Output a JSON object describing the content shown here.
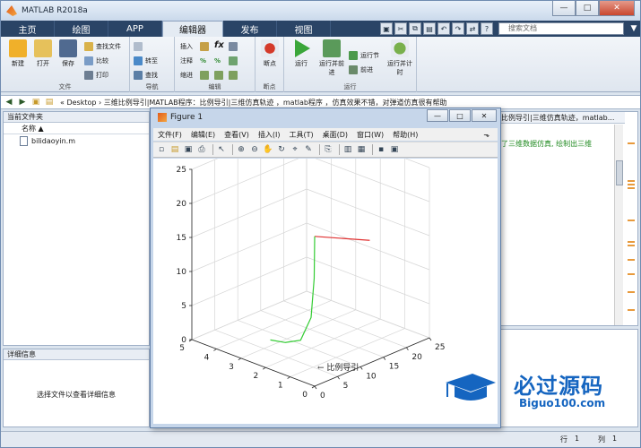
{
  "window": {
    "title": "MATLAB R2018a",
    "min": "—",
    "max": "□",
    "close": "✕"
  },
  "tabs": [
    {
      "label": "主页"
    },
    {
      "label": "绘图"
    },
    {
      "label": "APP"
    },
    {
      "label": "编辑器"
    },
    {
      "label": "发布"
    },
    {
      "label": "视图"
    }
  ],
  "search": {
    "placeholder": "搜索文档"
  },
  "ribbon": {
    "file_group": "文件",
    "new": "新建",
    "open": "打开",
    "save": "保存",
    "find_files": "查找文件",
    "compare": "比较",
    "print": "打印",
    "nav_group": "导航",
    "goto": "转至",
    "find": "查找",
    "edit_group": "编辑",
    "insert": "插入",
    "comment": "注释",
    "indent": "缩进",
    "bp_group": "断点",
    "breakpoints": "断点",
    "run_group": "运行",
    "run": "运行",
    "run_advance": "运行并前进",
    "run_section": "运行节",
    "advance": "前进",
    "run_time": "运行并计时"
  },
  "address": {
    "path": "« Desktop › 三维比例导引|MATLAB程序：比例导引|三维仿真轨迹 ，matlab程序 ，仿真效果不错，对弹道仿真很有帮助"
  },
  "file_panel": {
    "title": "当前文件夹",
    "col_name": "名称 ▲",
    "files": [
      "bilidaoyin.m"
    ]
  },
  "detail_panel": {
    "title": "详细信息",
    "message": "选择文件以查看详细信息"
  },
  "editor": {
    "tab": "比例导引|三维仿真轨迹，matlab...",
    "comment": "了三维数据仿真, 绘制出三维"
  },
  "status": {
    "row_label": "行",
    "row": "1",
    "col_label": "列",
    "col": "1"
  },
  "figure": {
    "title": "Figure 1",
    "menu": [
      "文件(F)",
      "编辑(E)",
      "查看(V)",
      "插入(I)",
      "工具(T)",
      "桌面(D)",
      "窗口(W)",
      "帮助(H)"
    ],
    "min": "—",
    "max": "□",
    "close": "✕"
  },
  "chart_data": {
    "type": "line3d",
    "title": "",
    "annotation": "← 比例导引",
    "xlim": [
      0,
      25
    ],
    "ylim": [
      0,
      5
    ],
    "zlim": [
      0,
      25
    ],
    "x_ticks": [
      "0",
      "5",
      "10",
      "15",
      "20",
      "25"
    ],
    "y_ticks": [
      "0",
      "1",
      "2",
      "3",
      "4",
      "5"
    ],
    "z_ticks": [
      "0",
      "5",
      "10",
      "15",
      "20",
      "25"
    ],
    "grid": true,
    "series": [
      {
        "color": "#e03030",
        "x": [
          0,
          12
        ],
        "y": [
          0,
          0
        ],
        "z": [
          22,
          18
        ]
      },
      {
        "color": "#33cc33",
        "x": [
          0,
          1.5,
          3.5,
          5.5,
          7,
          8
        ],
        "y": [
          0,
          0.3,
          0.8,
          1.6,
          2.5,
          3.3
        ],
        "z": [
          22,
          15,
          8,
          3,
          1,
          0
        ]
      }
    ]
  },
  "watermark": {
    "brand": "必过源码",
    "url": "Biguo100.com"
  },
  "colors": {
    "tabbar": "#2a4466",
    "accent": "#1565c0"
  }
}
